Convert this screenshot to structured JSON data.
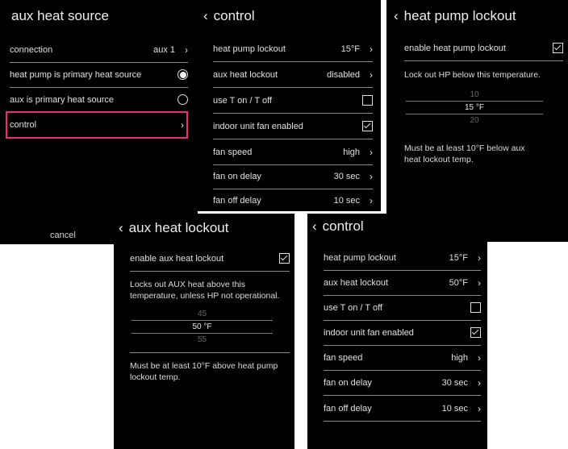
{
  "screens": {
    "aux_heat_source": {
      "title": "aux heat source",
      "connection_label": "connection",
      "connection_value": "aux 1",
      "hp_primary_label": "heat pump is primary heat source",
      "aux_primary_label": "aux is primary heat source",
      "control_label": "control",
      "cancel_label": "cancel",
      "highlight_color": "#e8317a"
    },
    "control_a": {
      "title": "control",
      "hp_lockout_label": "heat pump lockout",
      "hp_lockout_value": "15°F",
      "aux_lockout_label": "aux heat lockout",
      "aux_lockout_value": "disabled",
      "use_t_label": "use T on / T off",
      "indoor_fan_label": "indoor unit fan enabled",
      "fan_speed_label": "fan speed",
      "fan_speed_value": "high",
      "fan_on_label": "fan on delay",
      "fan_on_value": "30 sec",
      "fan_off_label": "fan off delay",
      "fan_off_value": "10 sec"
    },
    "hp_lockout": {
      "title": "heat pump lockout",
      "enable_label": "enable heat pump lockout",
      "desc": "Lock out HP below this temperature.",
      "picker_above": "10",
      "picker_selected": "15 °F",
      "picker_below": "20",
      "note": "Must be at least 10°F below aux heat lockout temp."
    },
    "aux_lockout": {
      "title": "aux heat lockout",
      "enable_label": "enable aux heat lockout",
      "desc": "Locks out AUX heat above this temperature, unless HP not operational.",
      "picker_above": "45",
      "picker_selected": "50 °F",
      "picker_below": "55",
      "note": "Must be at least 10°F above heat pump lockout temp."
    },
    "control_b": {
      "title": "control",
      "hp_lockout_label": "heat pump lockout",
      "hp_lockout_value": "15°F",
      "aux_lockout_label": "aux heat lockout",
      "aux_lockout_value": "50°F",
      "use_t_label": "use T on / T off",
      "indoor_fan_label": "indoor unit fan enabled",
      "fan_speed_label": "fan speed",
      "fan_speed_value": "high",
      "fan_on_label": "fan on delay",
      "fan_on_value": "30 sec",
      "fan_off_label": "fan off delay",
      "fan_off_value": "10 sec"
    }
  },
  "icons": {
    "back": "chevron-left-icon",
    "chevron": "chevron-right-icon",
    "checkbox": "checkbox-icon",
    "radio": "radio-icon"
  }
}
